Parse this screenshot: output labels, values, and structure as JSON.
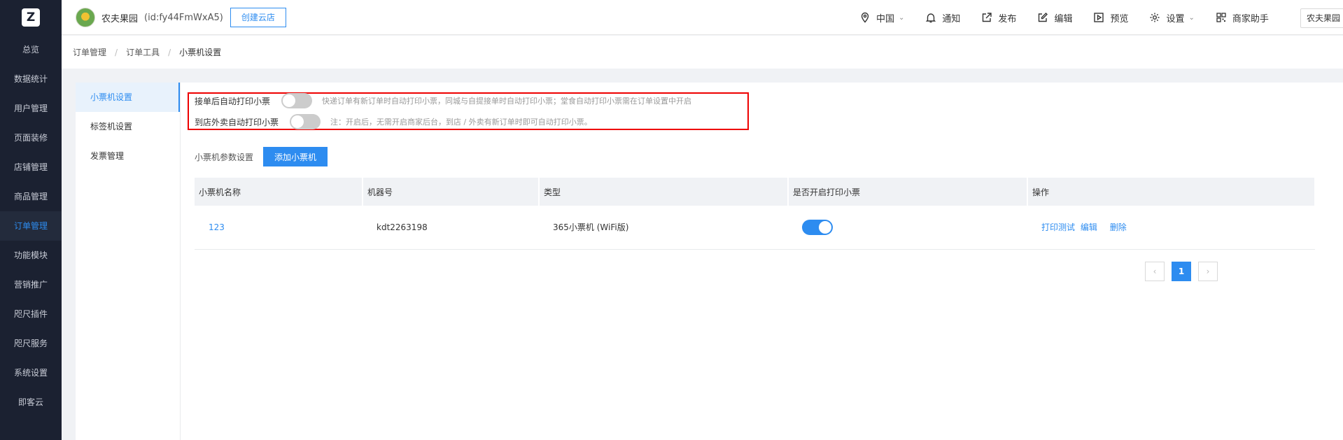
{
  "sidebar": {
    "logo": "Z",
    "items": [
      "总览",
      "数据统计",
      "用户管理",
      "页面装修",
      "店铺管理",
      "商品管理",
      "订单管理",
      "功能模块",
      "营销推广",
      "咫尺插件",
      "咫尺服务",
      "系统设置",
      "即客云"
    ],
    "active_index": 6
  },
  "header": {
    "store_name": "农夫果园",
    "store_id": "(id:fy44FmWxA5)",
    "create_button": "创建云店",
    "region": "中国",
    "notify": "通知",
    "publish": "发布",
    "edit": "编辑",
    "preview": "预览",
    "settings": "设置",
    "assistant": "商家助手",
    "store_select": "农夫果园"
  },
  "breadcrumb": [
    "订单管理",
    "订单工具",
    "小票机设置"
  ],
  "subnav": [
    "小票机设置",
    "标签机设置",
    "发票管理"
  ],
  "options": {
    "auto_print_label": "接单后自动打印小票",
    "auto_print_on": false,
    "auto_print_hint": "快递订单有新订单时自动打印小票，同城与自提接单时自动打印小票；堂食自动打印小票需在订单设置中开启",
    "dine_print_label": "到店外卖自动打印小票",
    "dine_print_on": false,
    "dine_print_hint": "注：开启后，无需开启商家后台，到店 / 外卖有新订单时即可自动打印小票。"
  },
  "params": {
    "label": "小票机参数设置",
    "add_button": "添加小票机"
  },
  "table": {
    "headers": [
      "小票机名称",
      "机器号",
      "类型",
      "是否开启打印小票",
      "操作"
    ],
    "rows": [
      {
        "name": "123",
        "machine_no": "kdt2263198",
        "type": "365小票机 (WiFi版)",
        "enabled": true,
        "actions": [
          "打印测试",
          "编辑",
          "删除"
        ]
      }
    ]
  },
  "pagination": {
    "prev": "‹",
    "current": "1",
    "next": "›"
  },
  "colors": {
    "accent": "#2d8cf0",
    "nav_bg": "#1b2131",
    "highlight": "#e00000"
  }
}
